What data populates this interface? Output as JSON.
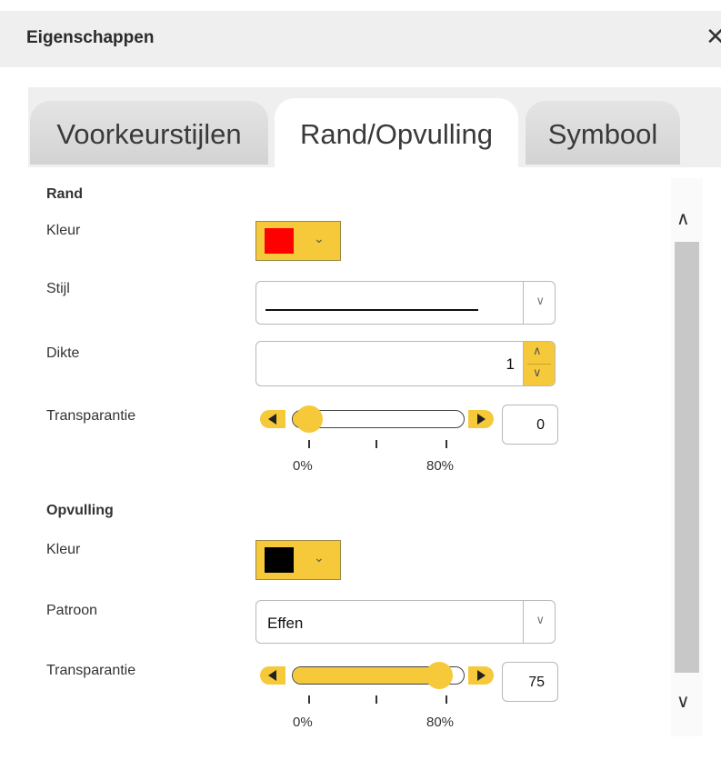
{
  "window": {
    "title": "Eigenschappen",
    "close_glyph": "✕"
  },
  "tabs": [
    {
      "label": "Voorkeurstijlen",
      "active": false
    },
    {
      "label": "Rand/Opvulling",
      "active": true
    },
    {
      "label": "Symbool",
      "active": false
    }
  ],
  "rand": {
    "heading": "Rand",
    "kleur": {
      "label": "Kleur",
      "color": "#ff0000"
    },
    "stijl": {
      "label": "Stijl",
      "value": "solid-line"
    },
    "dikte": {
      "label": "Dikte",
      "value": "1"
    },
    "transparantie": {
      "label": "Transparantie",
      "value": "0",
      "fraction": 0.0,
      "tick_min": "0%",
      "tick_max": "80%"
    }
  },
  "opvulling": {
    "heading": "Opvulling",
    "kleur": {
      "label": "Kleur",
      "color": "#000000"
    },
    "patroon": {
      "label": "Patroon",
      "value": "Effen"
    },
    "transparantie": {
      "label": "Transparantie",
      "value": "75",
      "fraction": 0.9375,
      "tick_min": "0%",
      "tick_max": "80%"
    }
  },
  "icons": {
    "close": "close-icon",
    "dropdown": "chevron-down-icon",
    "spin_up": "chevron-up-icon",
    "spin_down": "chevron-down-icon",
    "slider_left": "arrow-left-icon",
    "slider_right": "arrow-right-icon",
    "scroll_up": "chevron-up-icon",
    "scroll_down": "chevron-down-icon"
  },
  "colors": {
    "accent": "#f6c93a",
    "header_bg": "#efefef",
    "tab_inactive": "#d9d9d9"
  }
}
